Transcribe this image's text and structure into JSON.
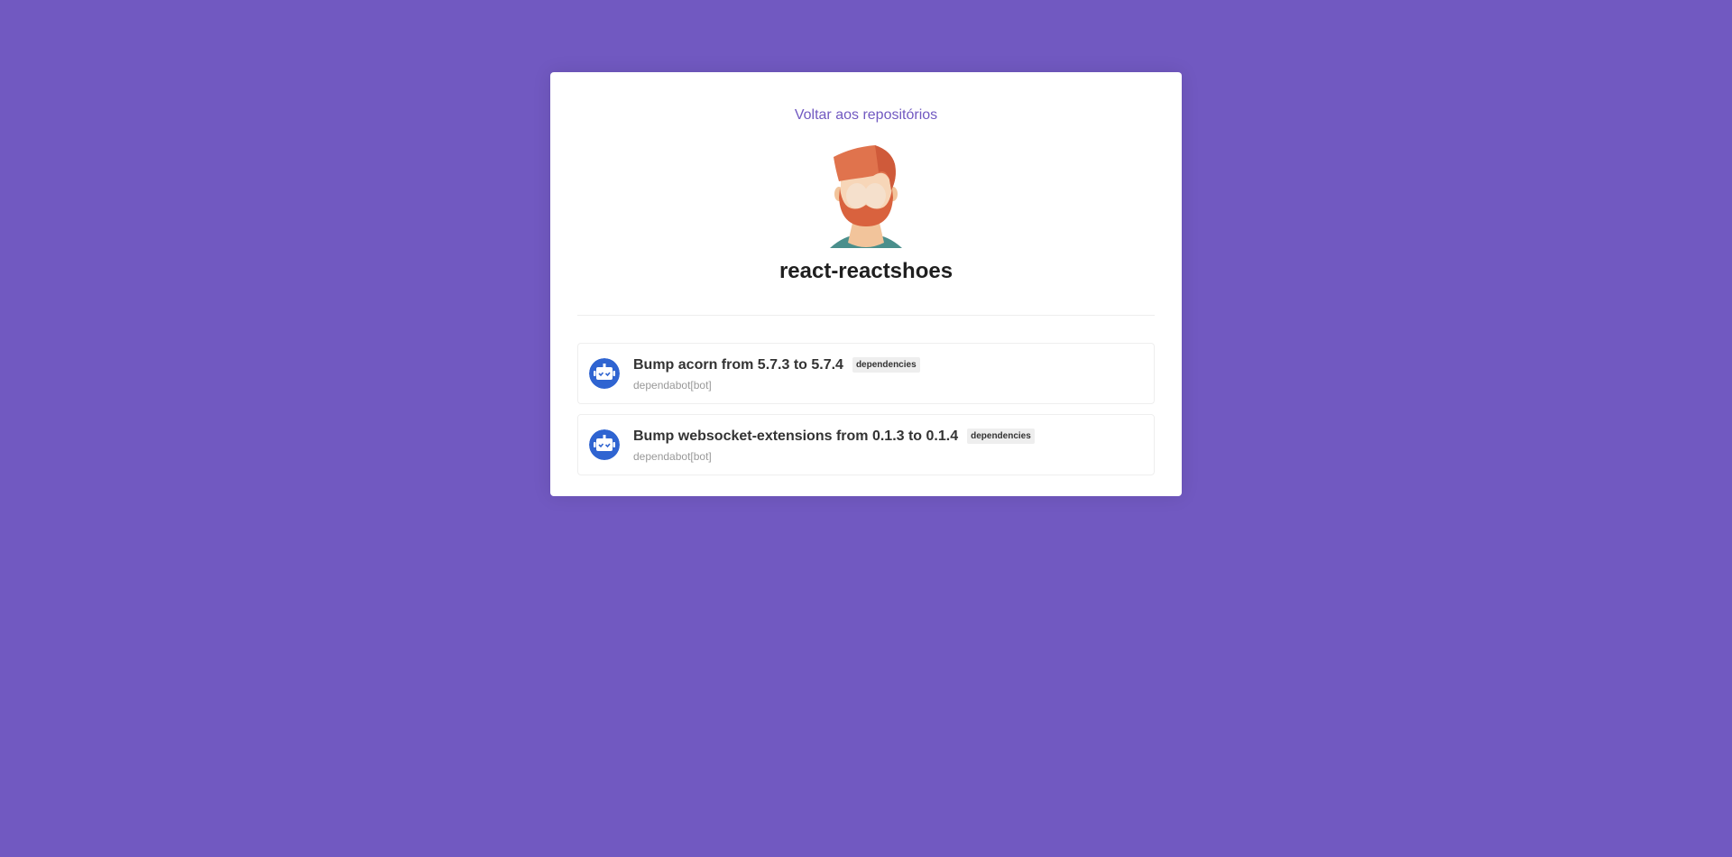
{
  "colors": {
    "background": "#7159c1",
    "accent": "#7159c1",
    "card": "#ffffff",
    "bot_avatar": "#2f64d1"
  },
  "header": {
    "back_link_label": "Voltar aos repositórios",
    "owner_avatar_icon": "bearded-man-avatar-icon",
    "repo_name": "react-reactshoes"
  },
  "issues": [
    {
      "title": "Bump acorn from 5.7.3 to 5.7.4",
      "labels": [
        "dependencies"
      ],
      "author": "dependabot[bot]",
      "avatar_icon": "dependabot-icon"
    },
    {
      "title": "Bump websocket-extensions from 0.1.3 to 0.1.4",
      "labels": [
        "dependencies"
      ],
      "author": "dependabot[bot]",
      "avatar_icon": "dependabot-icon"
    }
  ]
}
